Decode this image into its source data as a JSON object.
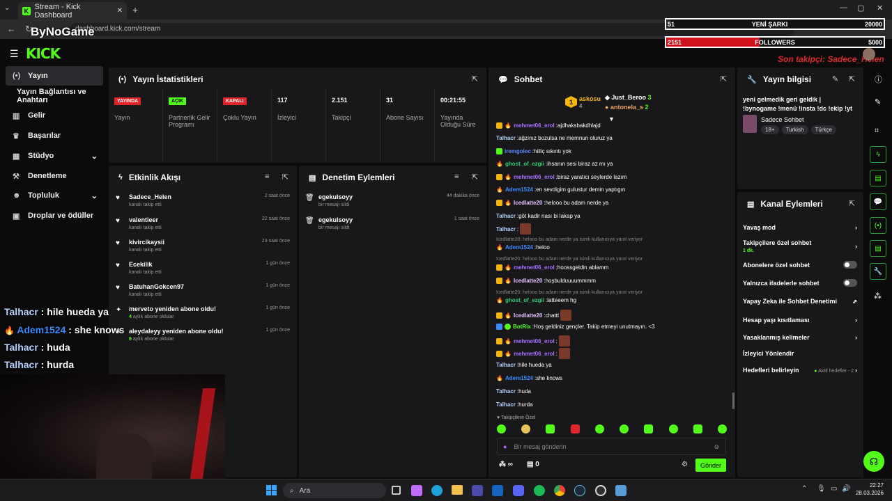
{
  "browser": {
    "tab_title": "Stream - Kick Dashboard",
    "url": "dashboard.kick.com/stream"
  },
  "overlay": {
    "song_count": "51",
    "song_label": "YENİ ŞARKI",
    "song_goal": "20000",
    "follower_count": "2151",
    "follower_label": "FOLLOWERS",
    "follower_goal": "5000",
    "last_follower": "Son takipçi: Sadece_Helen",
    "channel_watermark": "ByNoGame"
  },
  "app": {
    "logo": "KICK"
  },
  "sidebar": {
    "items": [
      {
        "label": "Yayın",
        "icon": "broadcast-icon"
      },
      {
        "label": "Yayın Bağlantısı ve Anahtarı",
        "icon": ""
      },
      {
        "label": "Gelir",
        "icon": "chart-icon"
      },
      {
        "label": "Başarılar",
        "icon": "trophy-icon"
      },
      {
        "label": "Stüdyo",
        "icon": "studio-icon"
      },
      {
        "label": "Denetleme",
        "icon": "hammer-icon"
      },
      {
        "label": "Topluluk",
        "icon": "users-icon"
      },
      {
        "label": "Droplar ve ödüller",
        "icon": "gift-icon"
      }
    ]
  },
  "stats": {
    "title": "Yayın İstatistikleri",
    "items": [
      {
        "value": "YAYINDA",
        "label": "Yayın",
        "badge": true,
        "color": "#e0262b"
      },
      {
        "value": "AÇIK",
        "label": "Partnerlik Gelir Programı",
        "badge": true,
        "color": "#53fc18"
      },
      {
        "value": "KAPALI",
        "label": "Çoklu Yayın",
        "badge": true,
        "color": "#e0262b"
      },
      {
        "value": "117",
        "label": "İzleyici",
        "badge": false
      },
      {
        "value": "2.151",
        "label": "Takipçi",
        "badge": false
      },
      {
        "value": "31",
        "label": "Abone Sayısı",
        "badge": false
      },
      {
        "value": "00:21:55",
        "label": "Yayında Olduğu Süre",
        "badge": false
      }
    ]
  },
  "activity": {
    "title": "Etkinlik Akışı",
    "items": [
      {
        "name": "Sadece_Helen",
        "sub": "kanalı takip etti",
        "time": "2 saat önce",
        "icon": "heart"
      },
      {
        "name": "valentieer",
        "sub": "kanalı takip etti",
        "time": "22 saat önce",
        "icon": "heart"
      },
      {
        "name": "kivircikaysii",
        "sub": "kanalı takip etti",
        "time": "23 saat önce",
        "icon": "heart"
      },
      {
        "name": "Ecekilik",
        "sub": "kanalı takip etti",
        "time": "1 gün önce",
        "icon": "heart"
      },
      {
        "name": "BatuhanGokcen97",
        "sub": "kanalı takip etti",
        "time": "1 gün önce",
        "icon": "heart"
      },
      {
        "name": "merveto yeniden abone oldu!",
        "sub_num": "4",
        "sub": "aylık abone oldular",
        "time": "1 gün önce",
        "icon": "star"
      },
      {
        "name": "aleydaleyy yeniden abone oldu!",
        "sub_num": "6",
        "sub": "aylık abone oldular",
        "time": "1 gün önce",
        "icon": "star"
      }
    ]
  },
  "moderation": {
    "title": "Denetim Eylemleri",
    "items": [
      {
        "name": "egekulsoyy",
        "sub": "bir mesajı sildi",
        "time": "44 dakika önce"
      },
      {
        "name": "egekulsoyy",
        "sub": "bir mesajı sildi",
        "time": "1 saat önce"
      }
    ]
  },
  "chat": {
    "title": "Sohbet",
    "top": [
      {
        "name": "askosu",
        "count": "4",
        "rank": "1"
      },
      {
        "name": "Just_Beroo",
        "count": "3"
      },
      {
        "name": "antonela_s",
        "count": "2"
      }
    ],
    "messages": [
      {
        "user": "mehmet06_erol",
        "text": "ajdhakshakdhlajd",
        "color": "#a970ff",
        "badges": "cd"
      },
      {
        "user": "Talhacr",
        "text": "ağzınız bozulsa ne memnun oluruz ya",
        "color": "#b7d3ff",
        "badges": ""
      },
      {
        "user": "iremgolec",
        "text": "hiiliç sıkıntı yok",
        "color": "#5b8bff",
        "badges": "g"
      },
      {
        "user": "ghost_of_ezgii",
        "text": "ihsanın sesi biraz az mı ya",
        "color": "#2ecc71",
        "badges": "d"
      },
      {
        "user": "mehmet06_erol",
        "text": "biraz yaratıcı seylerde lazım",
        "color": "#a970ff",
        "badges": "cd"
      },
      {
        "user": "Adem1524",
        "text": "en sevdigim gulustur demin yaptıgın",
        "color": "#3a8bff",
        "badges": "d"
      },
      {
        "user": "Icedlatte20",
        "text": "helooo bu adam nerde ya",
        "color": "#e8c3ff",
        "badges": "cd"
      },
      {
        "user": "Talhacr",
        "text": "göt kadir nası bi lakap ya",
        "color": "#b7d3ff",
        "badges": ""
      },
      {
        "user": "Talhacr",
        "text": "",
        "color": "#b7d3ff",
        "badges": "",
        "emote": true
      },
      {
        "reply": "Icedlatte20: helooo bu adam nerde ya isimli kullanıcıya yanıt veriyor"
      },
      {
        "user": "Adem1524",
        "text": "heloo",
        "color": "#3a8bff",
        "badges": "d"
      },
      {
        "reply": "Icedlatte20: helooo bu adam nerde ya isimli kullanıcıya yanıt veriyor"
      },
      {
        "user": "mehmet06_erol",
        "text": "hoossgeldin ablamm",
        "color": "#a970ff",
        "badges": "cd"
      },
      {
        "user": "Icedlatte20",
        "text": "hoşbulduuuummmm",
        "color": "#e8c3ff",
        "badges": "cd"
      },
      {
        "reply": "Icedlatte20: helooo bu adam nerde ya isimli kullanıcıya yanıt veriyor"
      },
      {
        "user": "ghost_of_ezgii",
        "text": "latteeem hg",
        "color": "#2ecc71",
        "badges": "d"
      },
      {
        "user": "Icedlatte20",
        "text": "chattt",
        "color": "#e8c3ff",
        "badges": "cd",
        "emote": true
      },
      {
        "user": "BotRix",
        "text": "Hoş geldiniz gençler. Takip etmeyi unutmayın. <3",
        "color": "#53fc18",
        "badges": "b"
      },
      {
        "user": "mehmet06_erol",
        "text": "",
        "color": "#a970ff",
        "badges": "cd",
        "emote": true
      },
      {
        "user": "mehmet06_erol",
        "text": "",
        "color": "#a970ff",
        "badges": "cd",
        "emote": true
      },
      {
        "user": "Talhacr",
        "text": "hile hueda ya",
        "color": "#b7d3ff",
        "badges": ""
      },
      {
        "user": "Adem1524",
        "text": "she knows",
        "color": "#3a8bff",
        "badges": "d"
      },
      {
        "user": "Talhacr",
        "text": "huda",
        "color": "#b7d3ff",
        "badges": ""
      },
      {
        "user": "Talhacr",
        "text": "hurda",
        "color": "#b7d3ff",
        "badges": ""
      }
    ],
    "followers_only": "Takipçilere Özel",
    "placeholder": "Bir mesaj gönderin",
    "infinity": "∞",
    "zero": "0",
    "send": "Gönder"
  },
  "stream_info": {
    "title": "Yayın bilgisi",
    "text": "yeni gelmedik geri geldik | !bynogame !menü !insta !dc !ekip !yt",
    "category": "Sadece Sohbet",
    "tags": [
      "18+",
      "Turkish",
      "Türkçe"
    ]
  },
  "channel_actions": {
    "title": "Kanal Eylemleri",
    "items": [
      {
        "label": "Yavaş mod",
        "ctrl": "arrow"
      },
      {
        "label": "Takipçilere özel sohbet",
        "sub": "1 dk.",
        "ctrl": "arrow"
      },
      {
        "label": "Abonelere özel sohbet",
        "ctrl": "toggle"
      },
      {
        "label": "Yalnızca ifadelerle sohbet",
        "ctrl": "toggle"
      },
      {
        "label": "Yapay Zeka ile Sohbet Denetimi",
        "ctrl": "ext"
      },
      {
        "label": "Hesap yaşı kısıtlaması",
        "ctrl": "arrow"
      },
      {
        "label": "Yasaklanmış kelimeler",
        "ctrl": "arrow"
      },
      {
        "label": "İzleyici Yönlendir",
        "ctrl": ""
      },
      {
        "label": "Hedefleri belirleyin",
        "ctrl": "arrow",
        "extra": "Aktif hedefler - 2"
      }
    ]
  },
  "overlay_chat": [
    {
      "user": "Talhacr",
      "text": "hile hueda ya",
      "color": "#b7d3ff"
    },
    {
      "user": "Adem1524",
      "text": "she knows",
      "color": "#3a8bff"
    },
    {
      "user": "Talhacr",
      "text": "huda",
      "color": "#b7d3ff"
    },
    {
      "user": "Talhacr",
      "text": "hurda",
      "color": "#b7d3ff"
    }
  ],
  "taskbar": {
    "search": "Ara",
    "time": "22:27",
    "date": "28.03.2026"
  }
}
